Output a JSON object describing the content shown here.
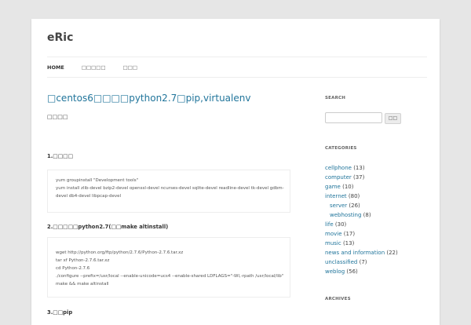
{
  "site": {
    "title": "eRic"
  },
  "nav": {
    "items": [
      {
        "label": "HOME",
        "active": true
      },
      {
        "label": "□□□□□",
        "active": false
      },
      {
        "label": "□□□",
        "active": false
      }
    ]
  },
  "post": {
    "title": "□centos6□□□□python2.7□pip,virtualenv",
    "meta": "□□□□",
    "sections": [
      {
        "heading": "1.□□□□",
        "code": [
          "yum groupinstall \"Development tools\"",
          "yum install zlib-devel bzip2-devel openssl-devel ncurses-devel sqlite-devel readline-devel tk-devel gdbm-",
          "devel db4-devel libpcap-devel"
        ]
      },
      {
        "heading": "2.□□□□□python2.7(□□make altinstall)",
        "code": [
          "wget http://python.org/ftp/python/2.7.6/Python-2.7.6.tar.xz",
          "tar xf Python-2.7.6.tar.xz",
          "cd Python-2.7.6",
          "./configure --prefix=/usr/local --enable-unicode=ucs4 --enable-shared LDFLAGS=\"-Wl,-rpath /usr/local/lib\"",
          "make && make altinstall"
        ]
      },
      {
        "heading": "3.□□pip"
      }
    ]
  },
  "sidebar": {
    "search": {
      "title": "SEARCH",
      "button_label": "□□",
      "placeholder": ""
    },
    "categories": {
      "title": "CATEGORIES",
      "items": [
        {
          "name": "cellphone",
          "count": "(13)",
          "child": false
        },
        {
          "name": "computer",
          "count": "(37)",
          "child": false
        },
        {
          "name": "game",
          "count": "(10)",
          "child": false
        },
        {
          "name": "internet",
          "count": "(80)",
          "child": false
        },
        {
          "name": "server",
          "count": "(26)",
          "child": true
        },
        {
          "name": "webhosting",
          "count": "(8)",
          "child": true
        },
        {
          "name": "life",
          "count": "(30)",
          "child": false
        },
        {
          "name": "movie",
          "count": "(17)",
          "child": false
        },
        {
          "name": "music",
          "count": "(13)",
          "child": false
        },
        {
          "name": "news and information",
          "count": "(22)",
          "child": false
        },
        {
          "name": "unclassified",
          "count": "(7)",
          "child": false
        },
        {
          "name": "weblog",
          "count": "(56)",
          "child": false
        }
      ]
    },
    "archives": {
      "title": "ARCHIVES"
    }
  }
}
